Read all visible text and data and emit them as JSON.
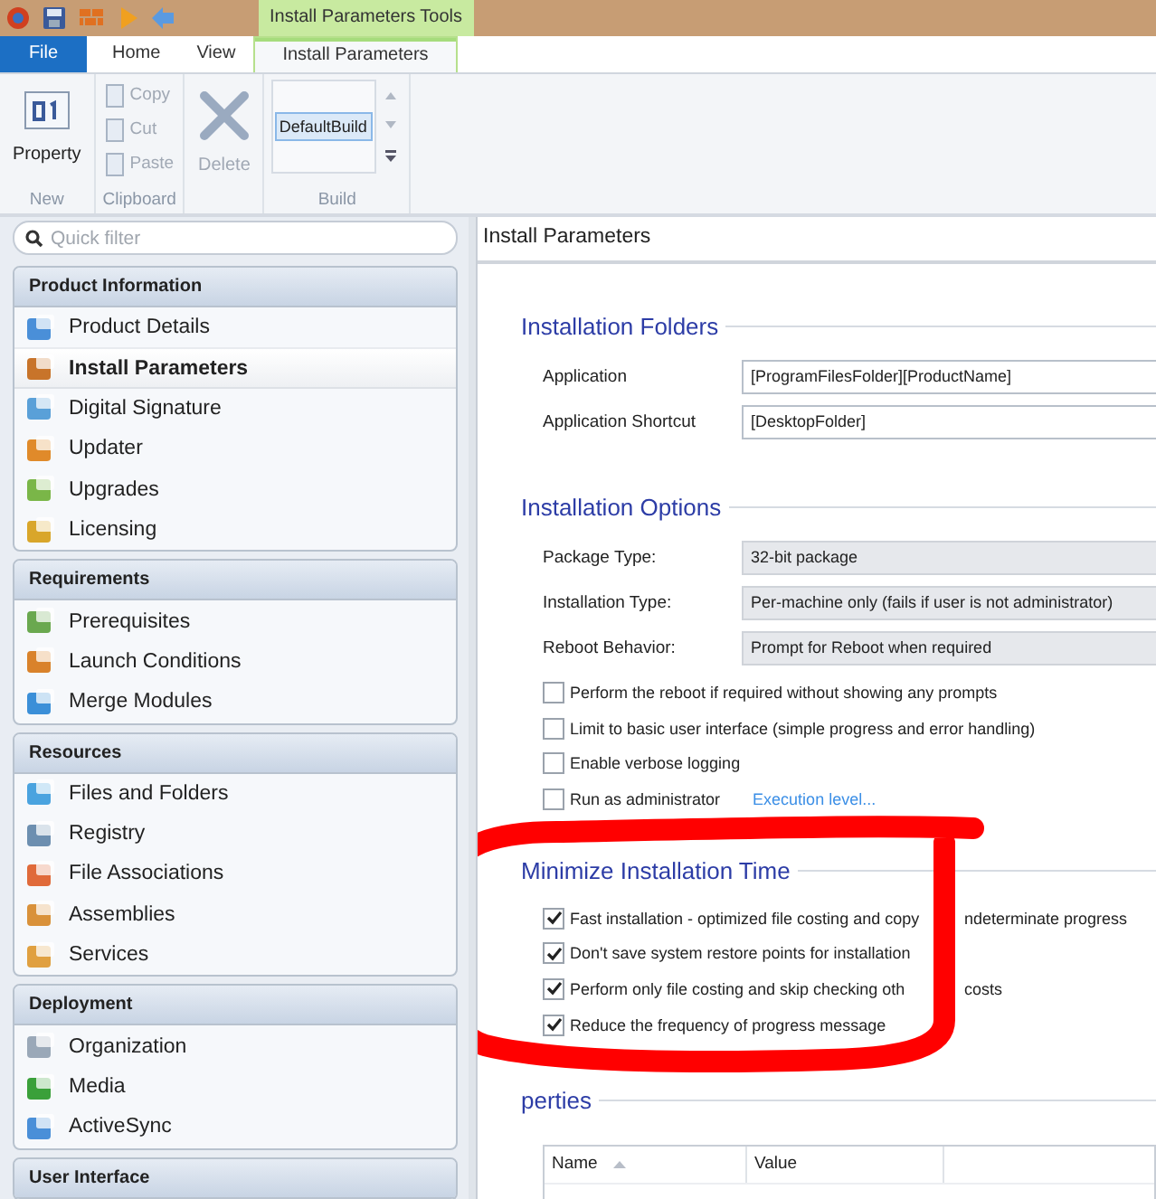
{
  "title_bar": {
    "context_tab": "Install Parameters Tools"
  },
  "ribbon_tabs": [
    {
      "label": "File",
      "kind": "file",
      "selected": false
    },
    {
      "label": "Home",
      "kind": "normal",
      "selected": false
    },
    {
      "label": "View",
      "kind": "normal",
      "selected": false
    },
    {
      "label": "Install Parameters",
      "kind": "context",
      "selected": true
    }
  ],
  "ribbon_groups": [
    {
      "label": "New",
      "buttons": [
        {
          "label": "Property",
          "kind": "large",
          "disabled": false
        }
      ]
    },
    {
      "label": "Clipboard",
      "buttons": [
        {
          "label": "Copy",
          "kind": "small",
          "disabled": true
        },
        {
          "label": "Cut",
          "kind": "small",
          "disabled": true
        },
        {
          "label": "Paste",
          "kind": "small",
          "disabled": true
        }
      ]
    },
    {
      "buttons": [
        {
          "label": "Delete",
          "kind": "large",
          "disabled": true
        }
      ]
    },
    {
      "label": "Build",
      "builds": [
        {
          "label": "DefaultBuild",
          "selected": true
        }
      ]
    }
  ],
  "sidebar": {
    "search": {
      "placeholder": "Quick filter"
    },
    "groups": [
      {
        "title": "Product Information",
        "items": [
          {
            "label": "Product Details",
            "selected": false
          },
          {
            "label": "Install Parameters",
            "selected": true
          },
          {
            "label": "Digital Signature",
            "selected": false
          },
          {
            "label": "Updater",
            "selected": false
          },
          {
            "label": "Upgrades",
            "selected": false
          },
          {
            "label": "Licensing",
            "selected": false
          }
        ]
      },
      {
        "title": "Requirements",
        "items": [
          {
            "label": "Prerequisites",
            "selected": false
          },
          {
            "label": "Launch Conditions",
            "selected": false
          },
          {
            "label": "Merge Modules",
            "selected": false
          }
        ]
      },
      {
        "title": "Resources",
        "items": [
          {
            "label": "Files and Folders",
            "selected": false
          },
          {
            "label": "Registry",
            "selected": false
          },
          {
            "label": "File Associations",
            "selected": false
          },
          {
            "label": "Assemblies",
            "selected": false
          },
          {
            "label": "Services",
            "selected": false
          }
        ]
      },
      {
        "title": "Deployment",
        "items": [
          {
            "label": "Organization",
            "selected": false
          },
          {
            "label": "Media",
            "selected": false
          },
          {
            "label": "ActiveSync",
            "selected": false
          }
        ]
      },
      {
        "title": "User Interface"
      }
    ]
  },
  "content": {
    "title": "Install Parameters",
    "sections": [
      {
        "title": "Installation Folders",
        "fields": [
          {
            "label": "Application",
            "value": "[ProgramFilesFolder][ProductName]",
            "kind": "text"
          },
          {
            "label": "Application Shortcut",
            "value": "[DesktopFolder]",
            "kind": "text"
          }
        ]
      },
      {
        "title": "Installation Options",
        "fields": [
          {
            "label": "Package Type:",
            "value": "32-bit package",
            "kind": "select"
          },
          {
            "label": "Installation Type:",
            "value": "Per-machine only (fails if user is not administrator)",
            "kind": "select"
          },
          {
            "label": "Reboot Behavior:",
            "value": "Prompt for Reboot when required",
            "kind": "select"
          }
        ],
        "checks": [
          {
            "parts": [
              "Perform the reboot if required without showing any prompts"
            ],
            "checked": false
          },
          {
            "parts": [
              "Limit to basic user interface (simple progress and error handling)"
            ],
            "checked": false
          },
          {
            "parts": [
              "Enable verbose logging"
            ],
            "checked": false
          },
          {
            "parts": [
              "Run as administrator"
            ],
            "checked": false,
            "link": "Execution level..."
          }
        ]
      },
      {
        "title": "Minimize Installation Time",
        "checks": [
          {
            "parts": [
              "Fast installation - optimized file costing and copy",
              "ndeterminate progress"
            ],
            "checked": true
          },
          {
            "parts": [
              "Don't save system restore points for installation"
            ],
            "checked": true
          },
          {
            "parts": [
              "Perform only file costing and skip checking oth",
              "costs"
            ],
            "checked": true
          },
          {
            "parts": [
              "Reduce the frequency of progress message"
            ],
            "checked": true
          }
        ]
      },
      {
        "title": "perties",
        "table": {
          "columns": [
            {
              "label": "Name",
              "sorted": true
            },
            {
              "label": "Value",
              "sorted": false
            }
          ]
        }
      }
    ]
  }
}
